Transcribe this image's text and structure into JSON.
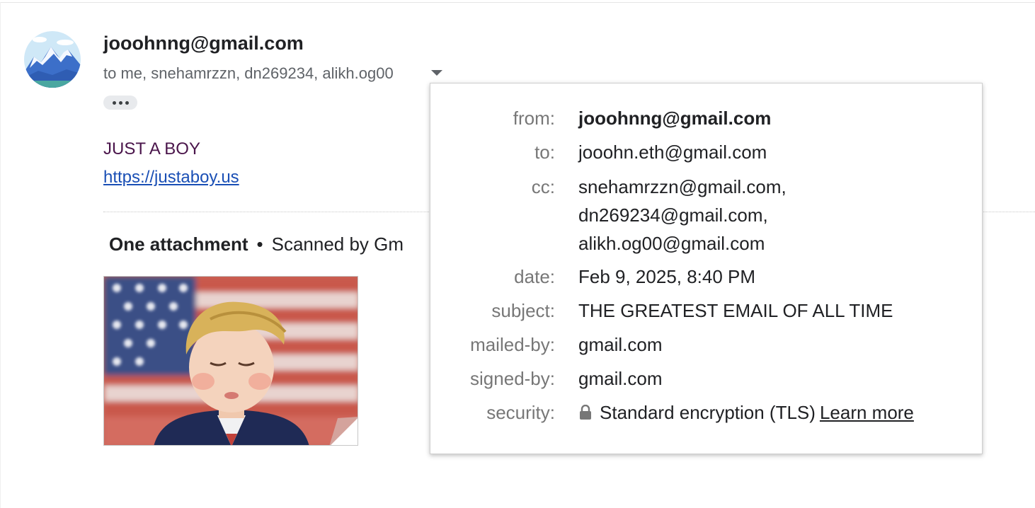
{
  "email": {
    "sender": "jooohnng@gmail.com",
    "recipients": "to me, snehamrzzn, dn269234, alikh.og00",
    "body_title": "JUST A BOY",
    "body_link": "https://justaboy.us"
  },
  "attachments": {
    "title": "One attachment",
    "separator": "•",
    "scanned": "Scanned by Gm"
  },
  "details": {
    "labels": {
      "from": "from:",
      "to": "to:",
      "cc": "cc:",
      "date": "date:",
      "subject": "subject:",
      "mailed_by": "mailed-by:",
      "signed_by": "signed-by:",
      "security": "security:"
    },
    "from": "jooohnng@gmail.com",
    "to": "jooohn.eth@gmail.com",
    "cc": [
      "snehamrzzn@gmail.com,",
      "dn269234@gmail.com,",
      "alikh.og00@gmail.com"
    ],
    "date": "Feb 9, 2025, 8:40 PM",
    "subject": "THE GREATEST EMAIL OF ALL TIME",
    "mailed_by": "gmail.com",
    "signed_by": "gmail.com",
    "security": "Standard encryption (TLS)",
    "learn_more": "Learn more"
  },
  "icons": [
    "avatar-image",
    "chevron-down-icon",
    "more-icon",
    "lock-icon",
    "attachment-thumbnail"
  ],
  "colors": {
    "link": "#1a4fb5",
    "title": "#4a154b",
    "muted": "#5f6368"
  }
}
